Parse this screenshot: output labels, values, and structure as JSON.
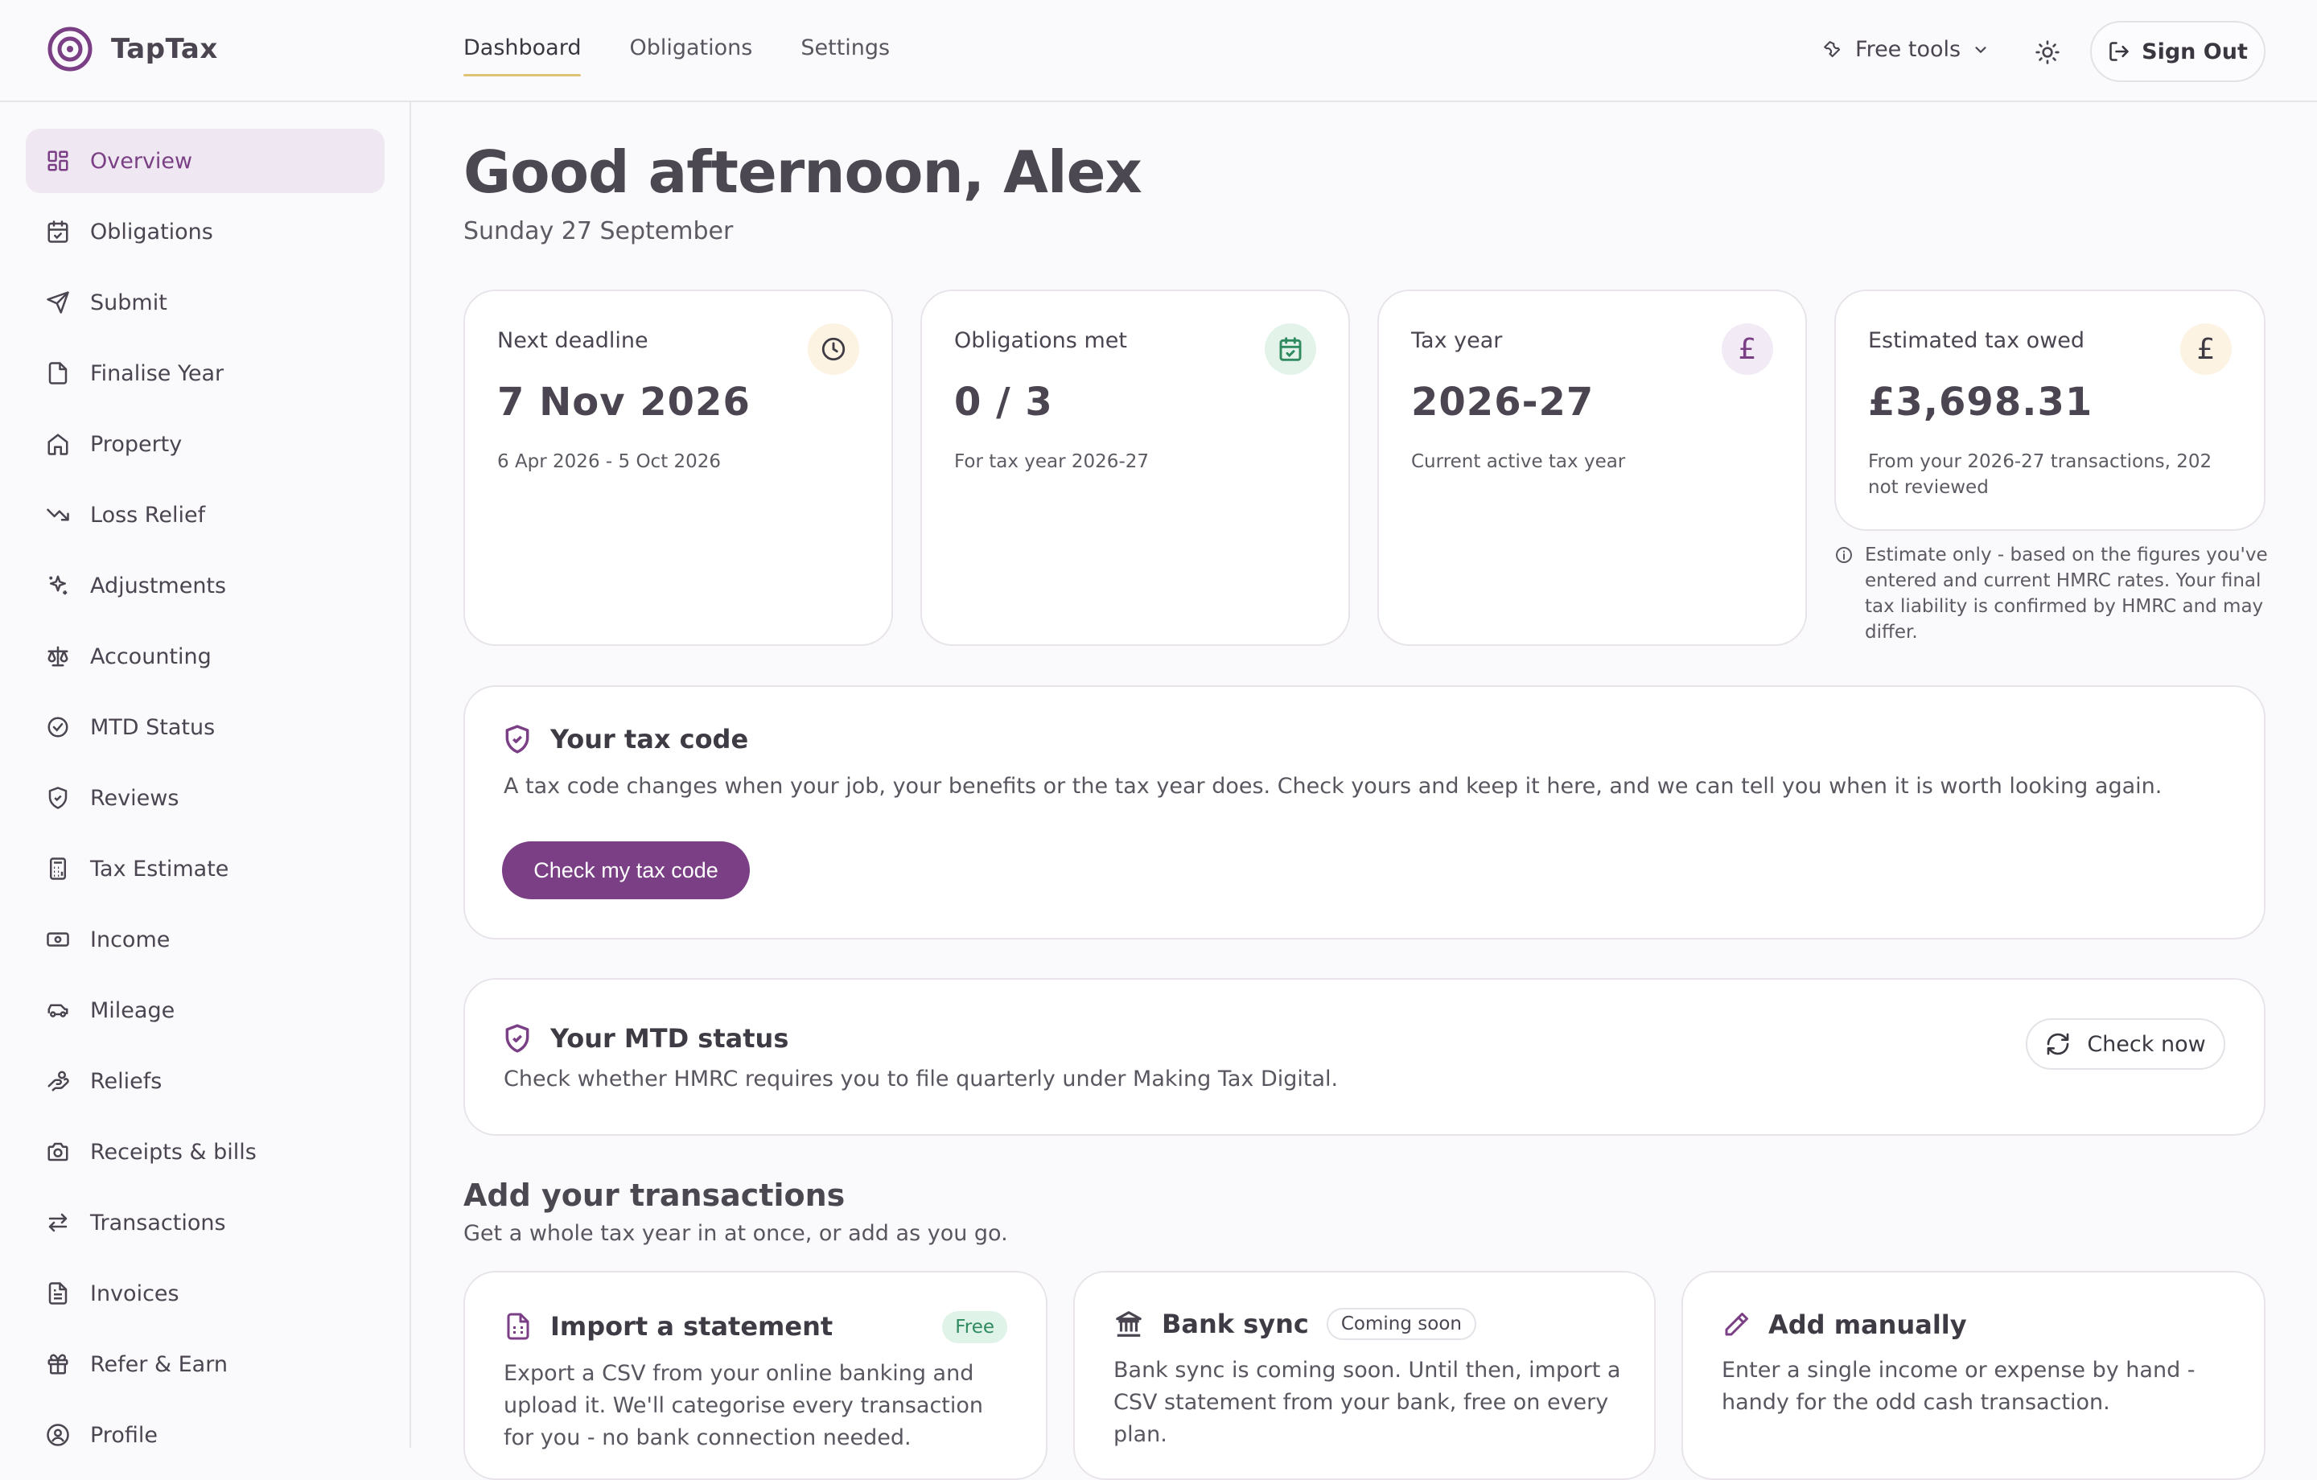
{
  "app": {
    "name": "TapTax"
  },
  "topnav": {
    "tabs": [
      {
        "label": "Dashboard",
        "active": true
      },
      {
        "label": "Obligations"
      },
      {
        "label": "Settings"
      }
    ]
  },
  "header": {
    "free_tools": "Free tools",
    "sign_out": "Sign Out"
  },
  "sidebar": {
    "items": [
      {
        "label": "Overview",
        "icon": "grid-icon",
        "active": true
      },
      {
        "label": "Obligations",
        "icon": "calendar-check-icon"
      },
      {
        "label": "Submit",
        "icon": "send-icon"
      },
      {
        "label": "Finalise Year",
        "icon": "document-icon"
      },
      {
        "label": "Property",
        "icon": "home-icon"
      },
      {
        "label": "Loss Relief",
        "icon": "trending-down-icon"
      },
      {
        "label": "Adjustments",
        "icon": "sparkles-icon"
      },
      {
        "label": "Accounting",
        "icon": "scales-icon"
      },
      {
        "label": "MTD Status",
        "icon": "check-circle-icon"
      },
      {
        "label": "Reviews",
        "icon": "shield-check-icon"
      },
      {
        "label": "Tax Estimate",
        "icon": "calculator-icon"
      },
      {
        "label": "Income",
        "icon": "banknote-icon"
      },
      {
        "label": "Mileage",
        "icon": "car-icon"
      },
      {
        "label": "Reliefs",
        "icon": "hand-coins-icon"
      },
      {
        "label": "Receipts & bills",
        "icon": "camera-icon"
      },
      {
        "label": "Transactions",
        "icon": "arrows-swap-icon"
      },
      {
        "label": "Invoices",
        "icon": "file-text-icon"
      },
      {
        "label": "Refer & Earn",
        "icon": "gift-icon"
      },
      {
        "label": "Profile",
        "icon": "user-icon"
      }
    ]
  },
  "greeting": {
    "title": "Good afternoon, Alex",
    "date": "Sunday 27 September"
  },
  "stats": [
    {
      "label": "Next deadline",
      "value": "7 Nov 2026",
      "sub": "6 Apr 2026 - 5 Oct 2026",
      "icon": "clock-icon"
    },
    {
      "label": "Obligations met",
      "value": "0 / 3",
      "sub": "For tax year 2026-27",
      "icon": "calendar-check-icon"
    },
    {
      "label": "Tax year",
      "value": "2026-27",
      "sub": "Current active tax year",
      "icon": "pound-icon"
    },
    {
      "label": "Estimated tax owed",
      "value": "£3,698.31",
      "sub": "From your 2026-27 transactions, 202 not reviewed",
      "icon": "pound-icon"
    }
  ],
  "estimate_note": "Estimate only - based on the figures you've entered and current HMRC rates. Your final tax liability is confirmed by HMRC and may differ.",
  "tax_code": {
    "title": "Your tax code",
    "text": "A tax code changes when your job, your benefits or the tax year does. Check yours and keep it here, and we can tell you when it is worth looking again.",
    "button": "Check my tax code"
  },
  "mtd": {
    "title": "Your MTD status",
    "text": "Check whether HMRC requires you to file quarterly under Making Tax Digital.",
    "button": "Check now"
  },
  "transactions": {
    "title": "Add your transactions",
    "subtitle": "Get a whole tax year in at once, or add as you go.",
    "cards": [
      {
        "title": "Import a statement",
        "badge": "Free",
        "text": "Export a CSV from your online banking and upload it. We'll categorise every transaction for you - no bank connection needed.",
        "icon": "file-spreadsheet-icon"
      },
      {
        "title": "Bank sync",
        "badge": "Coming soon",
        "text": "Bank sync is coming soon. Until then, import a CSV statement from your bank, free on every plan.",
        "icon": "bank-icon"
      },
      {
        "title": "Add manually",
        "text": "Enter a single income or expense by hand - handy for the odd cash transaction.",
        "icon": "pencil-icon"
      }
    ]
  },
  "colors": {
    "accent": "#7a3f85",
    "gold": "#e0c277",
    "green": "#2f8a5f"
  }
}
